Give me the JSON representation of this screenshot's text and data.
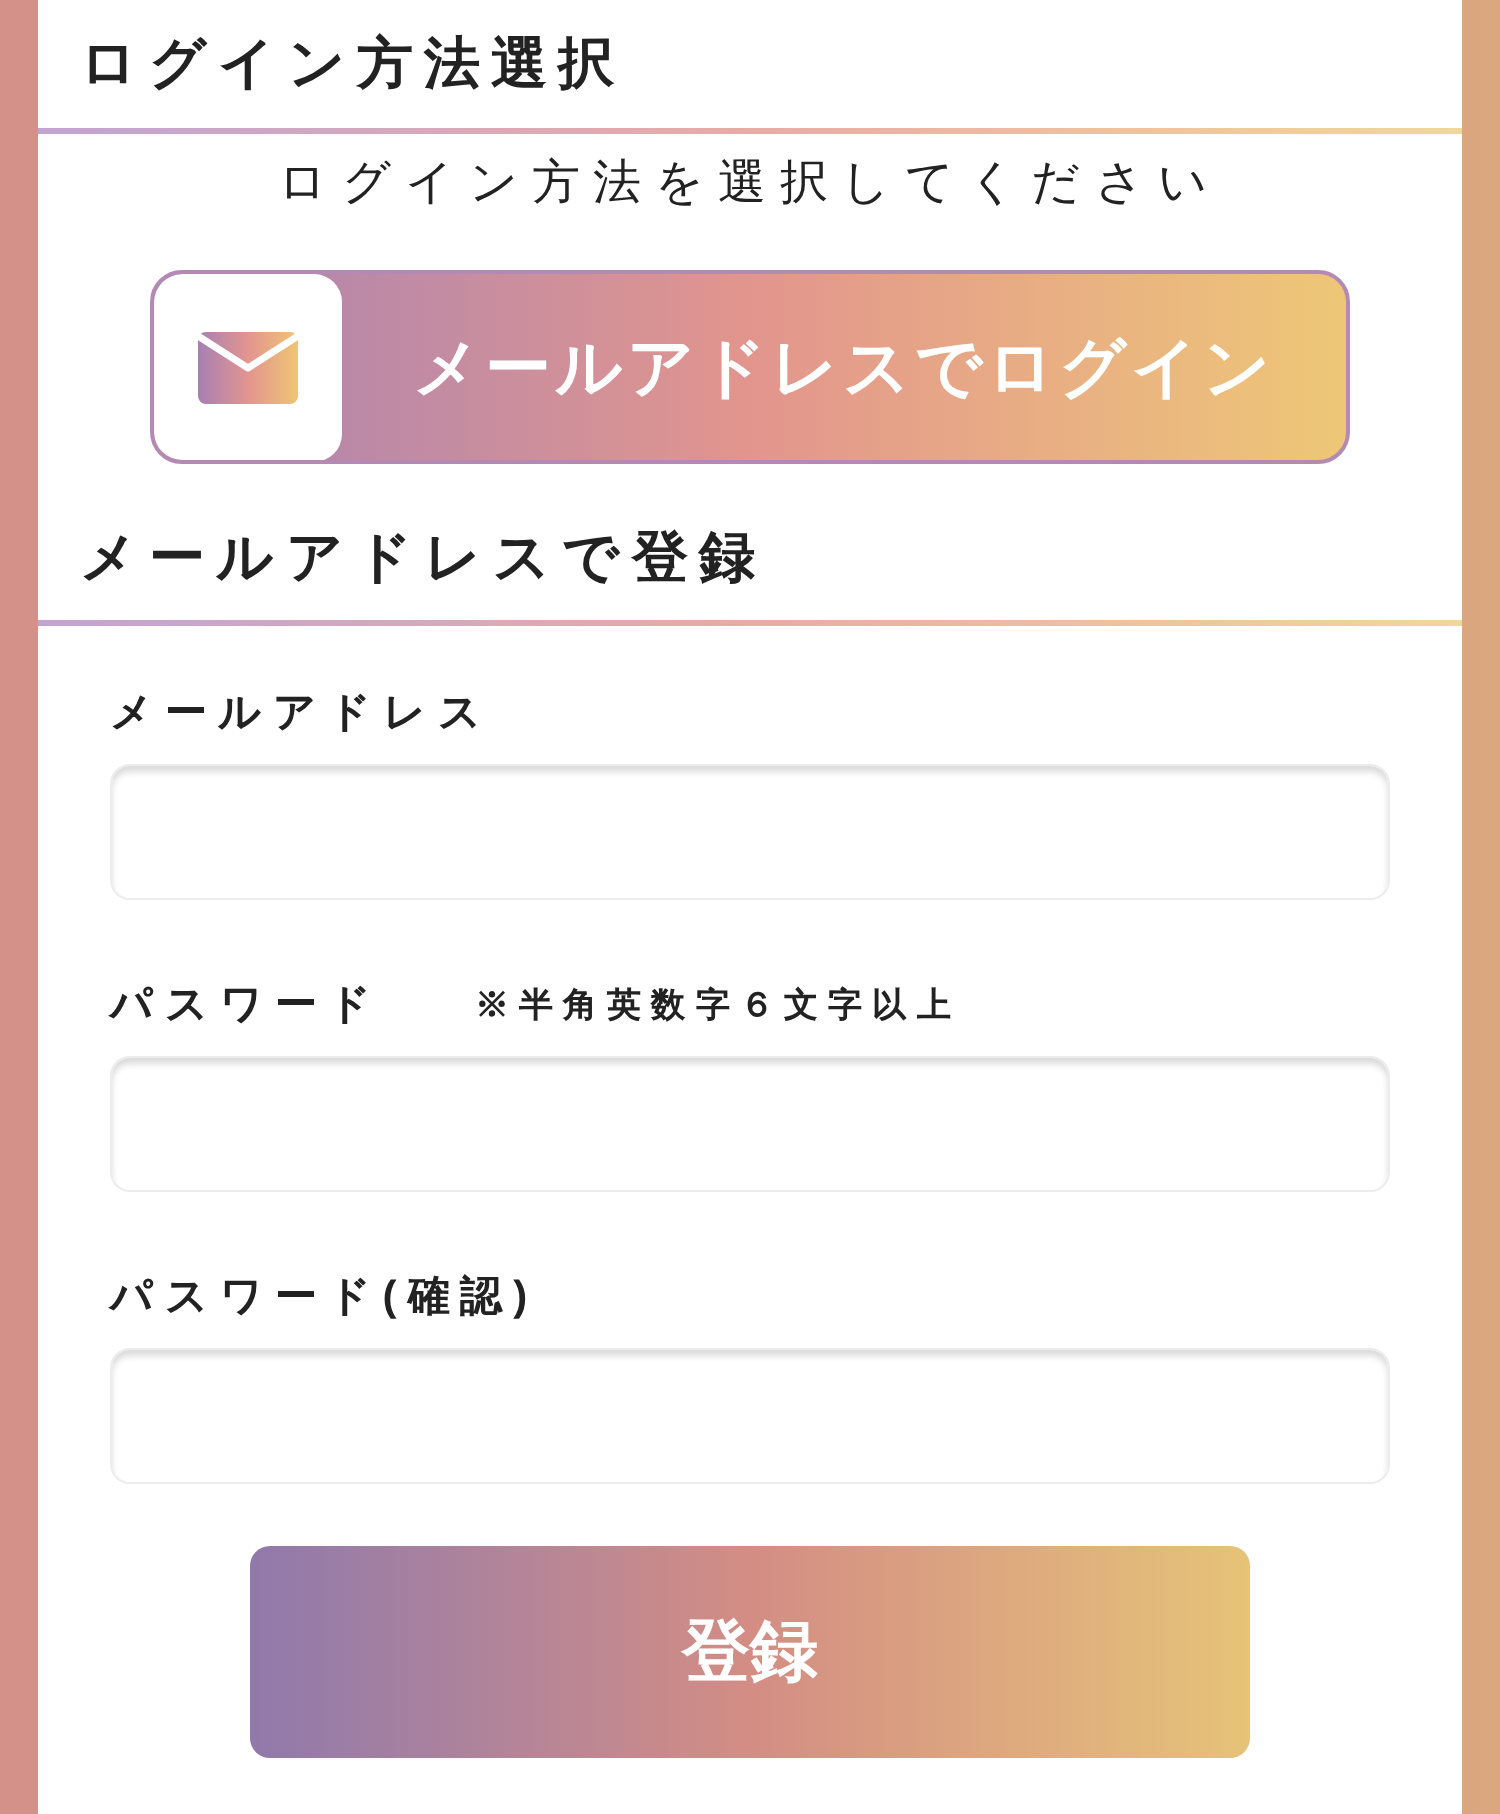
{
  "login_section": {
    "title": "ログイン方法選択",
    "instruction": "ログイン方法を選択してください",
    "login_button": {
      "label": "メールアドレスでログイン"
    }
  },
  "register_section": {
    "title": "メールアドレスで登録",
    "fields": [
      {
        "label": "メールアドレス"
      },
      {
        "label": "パスワード",
        "note": "※半角英数字６文字以上"
      },
      {
        "label": "パスワード(確認)"
      }
    ],
    "submit_button": {
      "label": "登録"
    }
  }
}
